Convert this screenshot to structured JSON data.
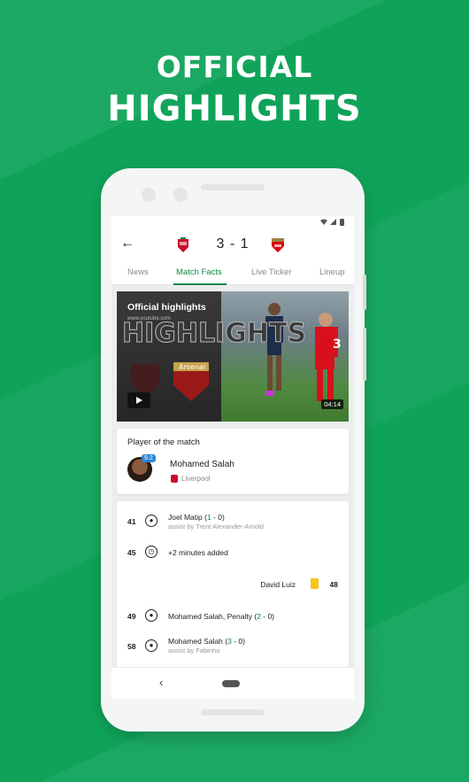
{
  "promo": {
    "line1": "OFFICIAL",
    "line2": "HIGHLIGHTS"
  },
  "colors": {
    "background": "#0fa35a",
    "accent": "#0b8a48",
    "rating_badge": "#2d86d8",
    "yellow_card": "#f5c518"
  },
  "status_bar": {
    "icons": [
      "wifi-icon",
      "signal-icon",
      "battery-icon"
    ]
  },
  "match": {
    "back_icon": "arrow-left-icon",
    "home_crest": "liverpool-crest-icon",
    "away_crest": "arsenal-crest-icon",
    "score": "3 - 1"
  },
  "tabs": [
    {
      "label": "News",
      "active": false
    },
    {
      "label": "Match Facts",
      "active": true
    },
    {
      "label": "Live Ticker",
      "active": false
    },
    {
      "label": "Lineup",
      "active": false
    }
  ],
  "video": {
    "title": "Official highlights",
    "url": "www.youtube.com",
    "overlay_text": "HIGHLIGHTS",
    "duration": "04:14",
    "play_icon": "play-icon"
  },
  "player_of_match": {
    "title": "Player of the match",
    "rating": "9.2",
    "name": "Mohamed Salah",
    "team": "Liverpool"
  },
  "events": [
    {
      "minute": "41",
      "icon": "ball-icon",
      "text_main": "Joel Matip (",
      "score_home": "1",
      "score_sep": " - 0)",
      "sub": "assist by Trent Alexander-Arnold"
    },
    {
      "minute": "45",
      "icon": "stopwatch-icon",
      "text_main": "+2 minutes added"
    },
    {
      "minute": "48",
      "icon": "yellow-card-icon",
      "text_main": "David Luiz"
    },
    {
      "minute": "49",
      "icon": "ball-icon",
      "text_main": "Mohamed Salah, Penalty (",
      "score_home": "2",
      "score_sep": " - 0)"
    },
    {
      "minute": "58",
      "icon": "ball-icon",
      "text_main": "Mohamed Salah (",
      "score_home": "3",
      "score_sep": " - 0)",
      "sub": "assist by Fabinho"
    }
  ],
  "navbar": {
    "back_icon": "nav-back-icon",
    "home_icon": "nav-home-icon"
  }
}
